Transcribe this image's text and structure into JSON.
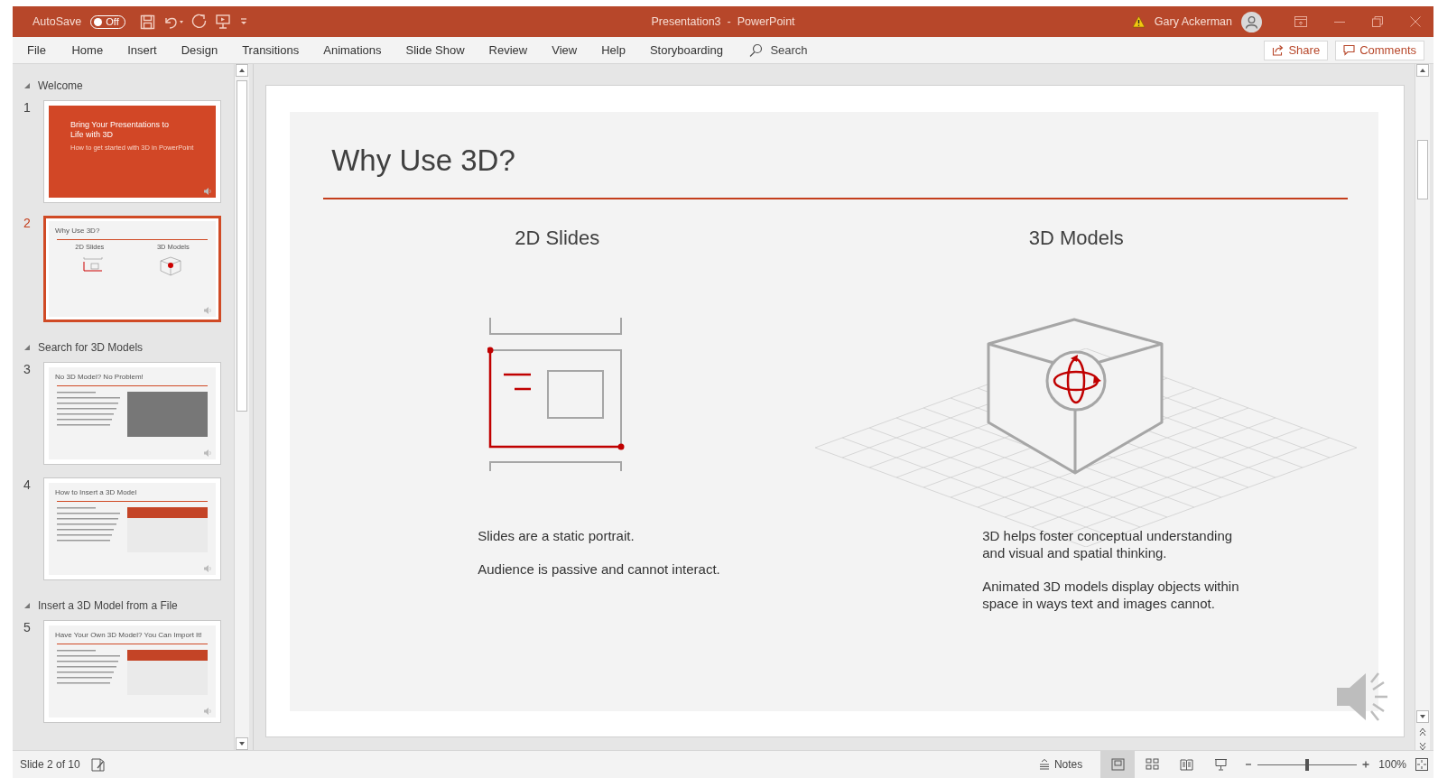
{
  "title_bar": {
    "autosave": {
      "label": "AutoSave",
      "on": false,
      "state": "Off"
    },
    "title": "Presentation3  -  PowerPoint",
    "user": "Gary Ackerman"
  },
  "ribbon": {
    "tabs": [
      {
        "label": "File",
        "selected": false
      },
      {
        "label": "Home",
        "selected": false
      },
      {
        "label": "Insert",
        "selected": false
      },
      {
        "label": "Design",
        "selected": false
      },
      {
        "label": "Transitions",
        "selected": false
      },
      {
        "label": "Animations",
        "selected": false
      },
      {
        "label": "Slide Show",
        "selected": false
      },
      {
        "label": "Review",
        "selected": false
      },
      {
        "label": "View",
        "selected": false
      },
      {
        "label": "Help",
        "selected": false
      },
      {
        "label": "Storyboarding",
        "selected": false
      }
    ],
    "search": "Search",
    "share": "Share",
    "comments": "Comments"
  },
  "slide_panel": {
    "sections": [
      {
        "title": "Welcome",
        "expanded": true,
        "slides": [
          {
            "number": "1",
            "selected": false,
            "kind": "title",
            "title": "Bring Your Presentations to Life with 3D",
            "subtitle": "How to get started with 3D in PowerPoint"
          },
          {
            "number": "2",
            "selected": true,
            "kind": "two-column",
            "title": "Why Use 3D?",
            "headings": [
              "2D Slides",
              "3D Models"
            ]
          }
        ]
      },
      {
        "title": "Search for 3D Models",
        "expanded": true,
        "slides": [
          {
            "number": "3",
            "selected": false,
            "kind": "gallery",
            "title": "No 3D Model? No Problem!"
          },
          {
            "number": "4",
            "selected": false,
            "kind": "screenshot",
            "title": "How to Insert a 3D Model"
          }
        ]
      },
      {
        "title": "Insert a 3D Model from a File",
        "expanded": true,
        "slides": [
          {
            "number": "5",
            "selected": false,
            "kind": "screenshot",
            "title": "Have Your Own 3D Model? You Can Import It!"
          }
        ]
      }
    ]
  },
  "slide": {
    "title": "Why Use 3D?",
    "columns": [
      {
        "kind": "flat",
        "heading": "2D Slides",
        "paragraphs": [
          "Slides are a static portrait.",
          "Audience is passive and cannot interact."
        ]
      },
      {
        "kind": "model",
        "heading": "3D Models",
        "paragraphs": [
          "3D helps foster conceptual understanding and visual and spatial thinking.",
          "Animated 3D models display objects within space in ways text and images cannot."
        ]
      }
    ]
  },
  "status_bar": {
    "slide_info": "Slide 2 of 10",
    "notes": "Notes",
    "views": [
      {
        "kind": "normal",
        "selected": true
      },
      {
        "kind": "sorter",
        "selected": false
      },
      {
        "kind": "reading",
        "selected": false
      },
      {
        "kind": "slideshow",
        "selected": false
      }
    ],
    "zoom": {
      "level": 0.5,
      "label": "100%"
    }
  }
}
